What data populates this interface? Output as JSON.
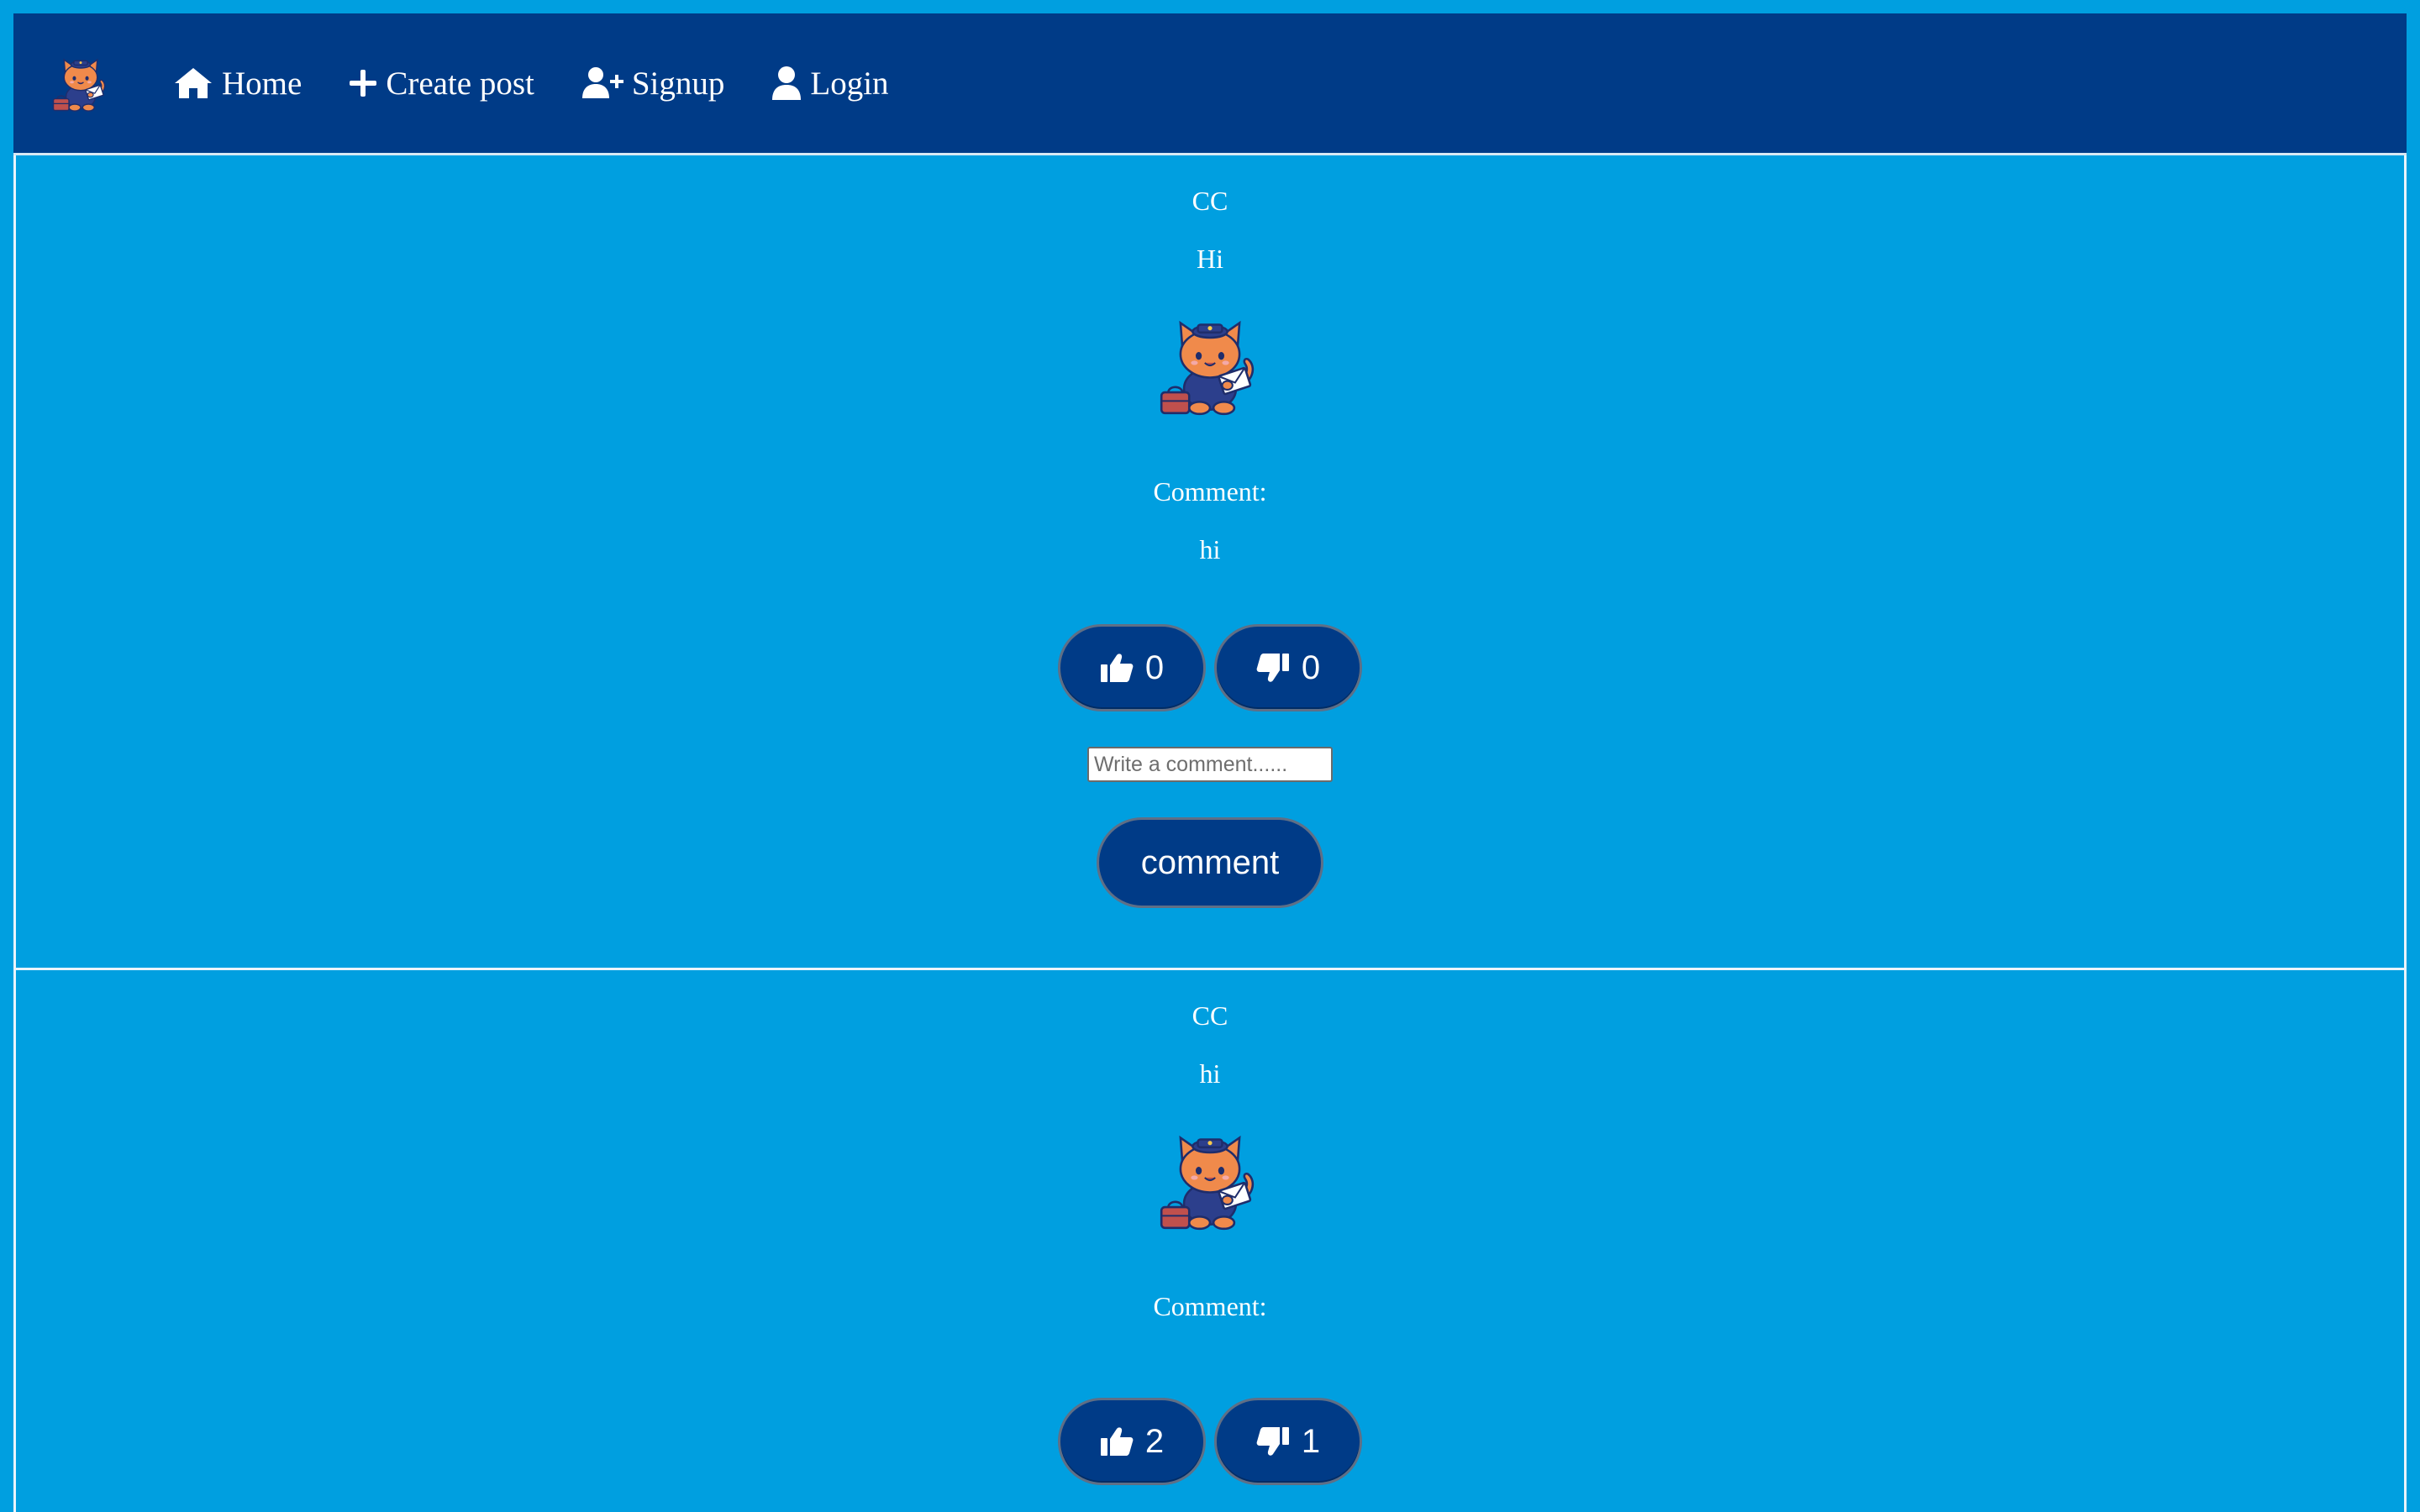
{
  "nav": {
    "logo_icon": "cat-mail-carrier-logo",
    "items": [
      {
        "label": "Home",
        "icon": "home-icon"
      },
      {
        "label": "Create post",
        "icon": "plus-icon"
      },
      {
        "label": "Signup",
        "icon": "user-plus-icon"
      },
      {
        "label": "Login",
        "icon": "user-icon"
      }
    ]
  },
  "colors": {
    "page_background": "#009fe0",
    "navbar": "#003b87",
    "button": "#003b87",
    "text": "#ffffff"
  },
  "posts": [
    {
      "author": "CC",
      "title": "Hi",
      "image_icon": "cat-mail-carrier-image",
      "comment_label": "Comment:",
      "comment_text": "hi",
      "likes": "0",
      "dislikes": "0",
      "comment_placeholder": "Write a comment......",
      "comment_button_label": "comment"
    },
    {
      "author": "CC",
      "title": "hi",
      "image_icon": "cat-mail-carrier-image",
      "comment_label": "Comment:",
      "likes": "2",
      "dislikes": "1"
    }
  ]
}
